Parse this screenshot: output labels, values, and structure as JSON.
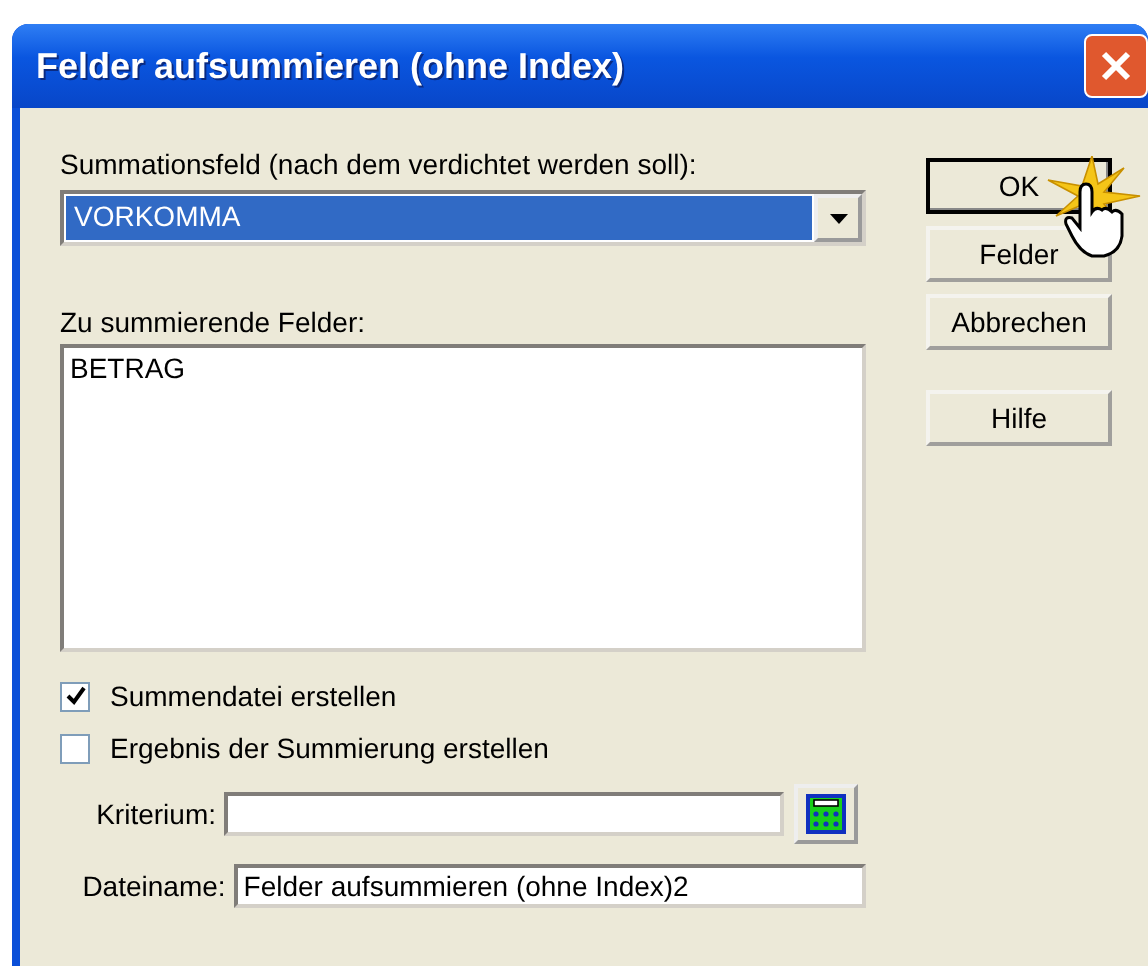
{
  "window": {
    "title": "Felder aufsummieren (ohne Index)"
  },
  "sum_field": {
    "label": "Summationsfeld (nach dem verdichtet werden soll):",
    "value": "VORKOMMA"
  },
  "fields_list": {
    "label": "Zu summierende Felder:",
    "items": [
      "BETRAG"
    ]
  },
  "checkboxes": [
    {
      "label": "Summendatei erstellen",
      "checked": true
    },
    {
      "label": "Ergebnis der Summierung erstellen",
      "checked": false
    }
  ],
  "criterion": {
    "label": "Kriterium:"
  },
  "filename": {
    "label": "Dateiname:",
    "value": "Felder aufsummieren (ohne Index)2"
  },
  "buttons": [
    {
      "label": "OK",
      "default": true
    },
    {
      "label": "Felder",
      "default": false
    },
    {
      "label": "Abbrechen",
      "default": false
    },
    {
      "label": "Hilfe",
      "default": false
    }
  ]
}
